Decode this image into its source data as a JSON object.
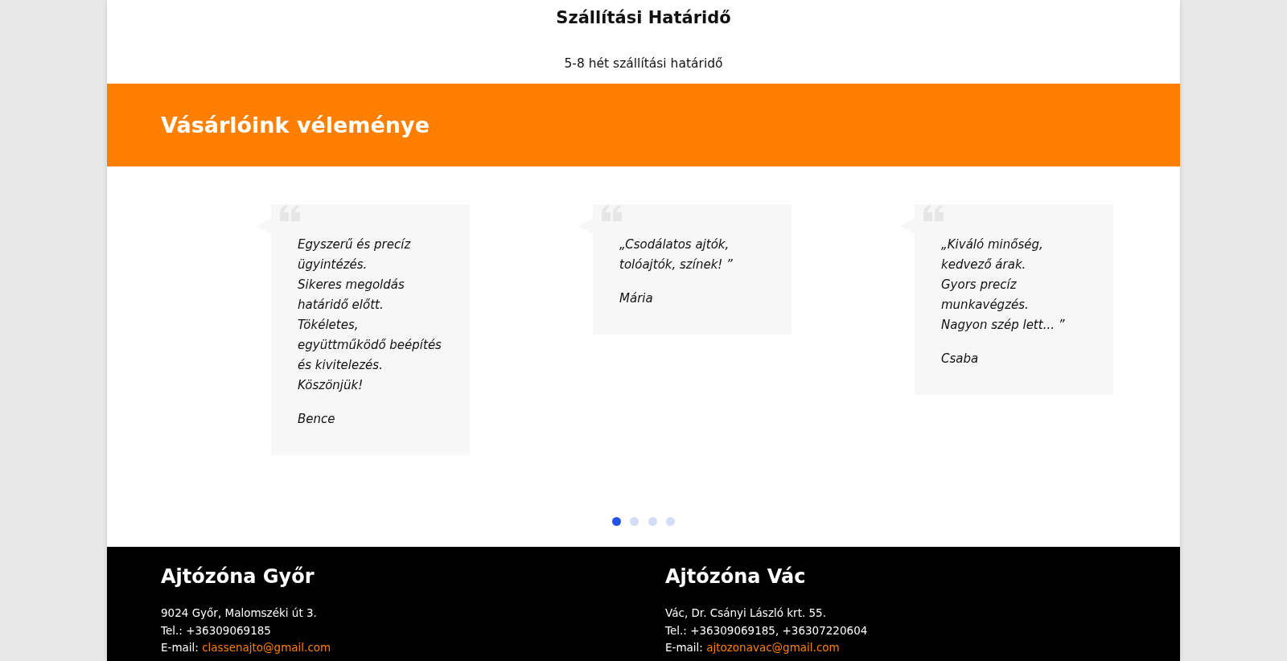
{
  "delivery": {
    "title": "Szállítási Határidő",
    "text": "5-8 hét szállítási határidő"
  },
  "testimonials": {
    "heading": "Vásárlóink véleménye",
    "items": [
      {
        "lines": [
          "Egyszerű és precíz",
          "ügyintézés.",
          "Sikeres megoldás",
          "határidő előtt.",
          "Tökéletes,",
          "együttműködő beépítés",
          "és kivitelezés.",
          "Köszönjük!"
        ],
        "author": "Bence"
      },
      {
        "lines": [
          "„Csodálatos ajtók,",
          "tolóajtók, színek! ”"
        ],
        "author": "Mária"
      },
      {
        "lines": [
          "„Kiváló minőség,",
          "kedvező árak.",
          "Gyors precíz",
          "munkavégzés.",
          "Nagyon szép lett... ”"
        ],
        "author": "Csaba"
      }
    ],
    "dots": [
      {
        "selected": true
      },
      {
        "selected": false
      },
      {
        "selected": false
      },
      {
        "selected": false
      }
    ]
  },
  "footer": {
    "locations": [
      {
        "name": "Ajtózóna Győr",
        "address": "9024 Győr, Malomszéki út 3.",
        "phone": "Tel.: +36309069185",
        "email_label": "E-mail:",
        "email": "classenajto@gmail.com"
      },
      {
        "name": "Ajtózóna Vác",
        "address": "Vác, Dr. Csányi László krt. 55.",
        "phone": "Tel.: +36309069185, +36307220604",
        "email_label": "E-mail:",
        "email": "ajtozonavac@gmail.com"
      }
    ]
  }
}
